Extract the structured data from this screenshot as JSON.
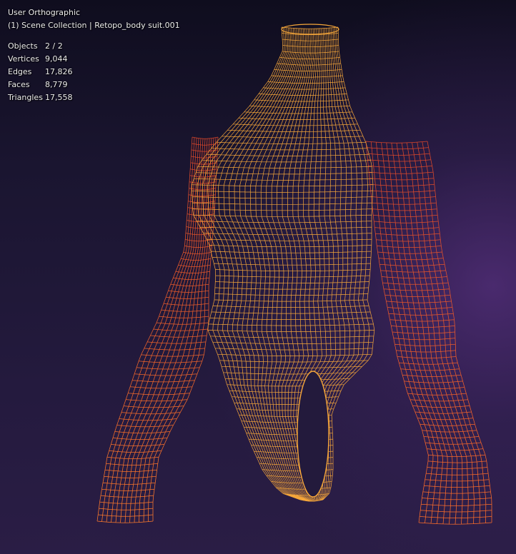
{
  "viewport": {
    "view_name": "User Orthographic",
    "collection_line": "(1) Scene Collection | Retopo_body suit.001"
  },
  "stats": [
    {
      "label": "Objects",
      "value": "2 / 2"
    },
    {
      "label": "Vertices",
      "value": "9,044"
    },
    {
      "label": "Edges",
      "value": "17,826"
    },
    {
      "label": "Faces",
      "value": "8,779"
    },
    {
      "label": "Triangles",
      "value": "17,558"
    }
  ],
  "colors": {
    "wire_torso": "#f5a63a",
    "wire_sleeve_top": "#e0522a",
    "wire_sleeve_bottom": "#ff7a2a"
  }
}
